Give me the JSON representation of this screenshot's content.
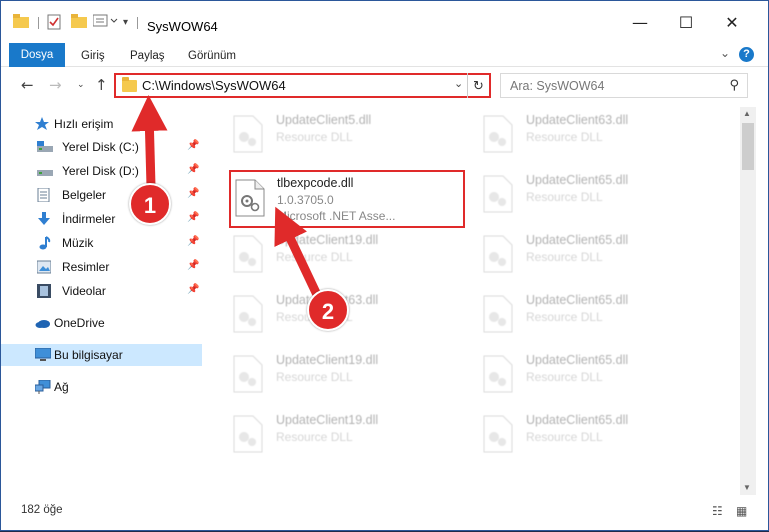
{
  "window": {
    "title": "SysWOW64",
    "minimize": "—",
    "maximize": "☐",
    "close": "✕"
  },
  "ribbon": {
    "tabs": [
      "Dosya",
      "Giriş",
      "Paylaş",
      "Görünüm"
    ],
    "help": "?"
  },
  "address": {
    "path": "C:\\Windows\\SysWOW64",
    "search_placeholder": "Ara: SysWOW64"
  },
  "sidebar": {
    "items": [
      {
        "label": "Hızlı erişim",
        "icon": "star-icon"
      },
      {
        "label": "Yerel Disk (C:)",
        "icon": "drive-icon"
      },
      {
        "label": "Yerel Disk (D:)",
        "icon": "drive-icon"
      },
      {
        "label": "Belgeler",
        "icon": "documents-icon"
      },
      {
        "label": "İndirmeler",
        "icon": "download-icon"
      },
      {
        "label": "Müzik",
        "icon": "music-icon"
      },
      {
        "label": "Resimler",
        "icon": "pictures-icon"
      },
      {
        "label": "Videolar",
        "icon": "videos-icon"
      },
      {
        "label": "OneDrive",
        "icon": "cloud-icon"
      },
      {
        "label": "Bu bilgisayar",
        "icon": "computer-icon"
      },
      {
        "label": "Ağ",
        "icon": "network-icon"
      }
    ]
  },
  "files": {
    "highlighted": {
      "name": "tlbexpcode.dll",
      "version": "1.0.3705.0",
      "desc": "Microsoft .NET Asse..."
    },
    "left_column": [
      {
        "name": "UpdateClient5.dll",
        "desc": "Resource DLL"
      },
      {
        "name": "UpdateClient19.dll",
        "desc": "Resource DLL"
      },
      {
        "name": "UpdateClient63.dll",
        "desc": "Resource DLL"
      },
      {
        "name": "UpdateClient19.dll",
        "desc": "Resource DLL"
      },
      {
        "name": "UpdateClient19.dll",
        "desc": "Resource DLL"
      }
    ],
    "right_column": [
      {
        "name": "UpdateClient63.dll",
        "desc": "Resource DLL"
      },
      {
        "name": "UpdateClient65.dll",
        "desc": "Resource DLL"
      },
      {
        "name": "UpdateClient65.dll",
        "desc": "Resource DLL"
      },
      {
        "name": "UpdateClient65.dll",
        "desc": "Resource DLL"
      },
      {
        "name": "UpdateClient65.dll",
        "desc": "Resource DLL"
      },
      {
        "name": "UpdateClient65.dll",
        "desc": "Resource DLL"
      }
    ]
  },
  "status": {
    "count": "182 öğe"
  },
  "annotations": {
    "step1": "1",
    "step2": "2"
  },
  "colors": {
    "accent": "#1979ca",
    "highlight": "#e02a2a",
    "selected": "#cce8ff"
  }
}
